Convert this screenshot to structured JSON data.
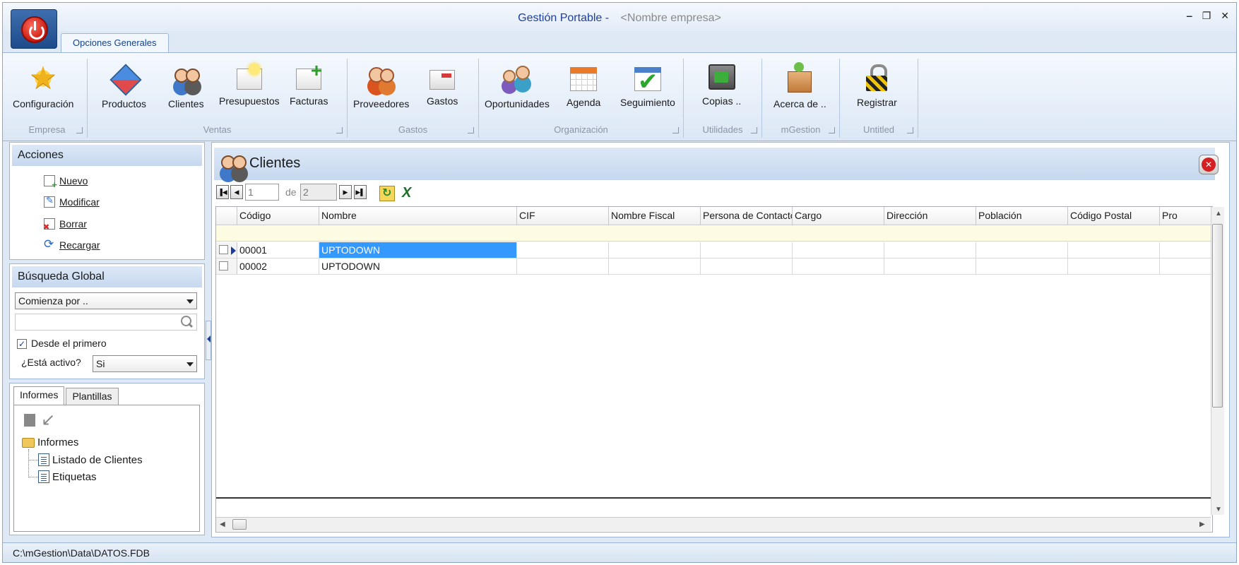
{
  "window": {
    "title_main": "Gestión Portable -",
    "title_company": "<Nombre empresa>",
    "controls": [
      "‒",
      "❐",
      "✕"
    ]
  },
  "ribbon": {
    "tab": "Opciones Generales",
    "groups": [
      {
        "label": "Empresa",
        "buttons": [
          {
            "label": "Configuración",
            "icon": "star-icon"
          }
        ]
      },
      {
        "label": "Ventas",
        "buttons": [
          {
            "label": "Productos",
            "icon": "products-icon"
          },
          {
            "label": "Clientes",
            "icon": "clients-icon"
          },
          {
            "label": "Presupuestos",
            "icon": "quotes-icon"
          },
          {
            "label": "Facturas",
            "icon": "invoices-icon"
          }
        ]
      },
      {
        "label": "Gastos",
        "buttons": [
          {
            "label": "Proveedores",
            "icon": "suppliers-icon"
          },
          {
            "label": "Gastos",
            "icon": "expenses-icon"
          }
        ]
      },
      {
        "label": "Organización",
        "buttons": [
          {
            "label": "Oportunidades",
            "icon": "opportunities-icon"
          },
          {
            "label": "Agenda",
            "icon": "calendar-icon"
          },
          {
            "label": "Seguimiento",
            "icon": "checklist-icon"
          }
        ]
      },
      {
        "label": "Utilidades",
        "buttons": [
          {
            "label": "Copias ..",
            "icon": "safe-icon"
          }
        ]
      },
      {
        "label": "mGestion",
        "buttons": [
          {
            "label": "Acerca de ..",
            "icon": "about-icon"
          }
        ]
      },
      {
        "label": "Untitled",
        "buttons": [
          {
            "label": "Registrar",
            "icon": "lock-icon"
          }
        ]
      }
    ]
  },
  "acciones": {
    "title": "Acciones",
    "items": [
      {
        "label": "Nuevo",
        "icon": "new-doc-icon"
      },
      {
        "label": "Modificar",
        "icon": "edit-doc-icon"
      },
      {
        "label": "Borrar",
        "icon": "delete-doc-icon"
      },
      {
        "label": "Recargar",
        "icon": "reload-icon"
      }
    ]
  },
  "busqueda": {
    "title": "Búsqueda Global",
    "mode": "Comienza por ..",
    "search_value": "",
    "desde_primero_label": "Desde el primero",
    "desde_primero_checked": true,
    "activo_label": "¿Está activo?",
    "activo_value": "Si"
  },
  "informes_panel": {
    "tabs": [
      "Informes",
      "Plantillas"
    ],
    "active_tab": "Informes",
    "tree_root": "Informes",
    "tree_items": [
      "Listado de Clientes",
      "Etiquetas"
    ]
  },
  "main": {
    "title": "Clientes",
    "nav": {
      "current": "1",
      "of_label": "de",
      "total": "2"
    },
    "columns": [
      "Código",
      "Nombre",
      "CIF",
      "Nombre Fiscal",
      "Persona de Contacto",
      "Cargo",
      "Dirección",
      "Población",
      "Código Postal",
      "Pro"
    ],
    "rows": [
      [
        "00001",
        "UPTODOWN",
        "",
        "",
        "",
        "",
        "",
        "",
        "",
        ""
      ],
      [
        "00002",
        "UPTODOWN",
        "",
        "",
        "",
        "",
        "",
        "",
        "",
        ""
      ]
    ],
    "selected_row": 0
  },
  "statusbar": {
    "path": "C:\\mGestion\\Data\\DATOS.FDB"
  }
}
